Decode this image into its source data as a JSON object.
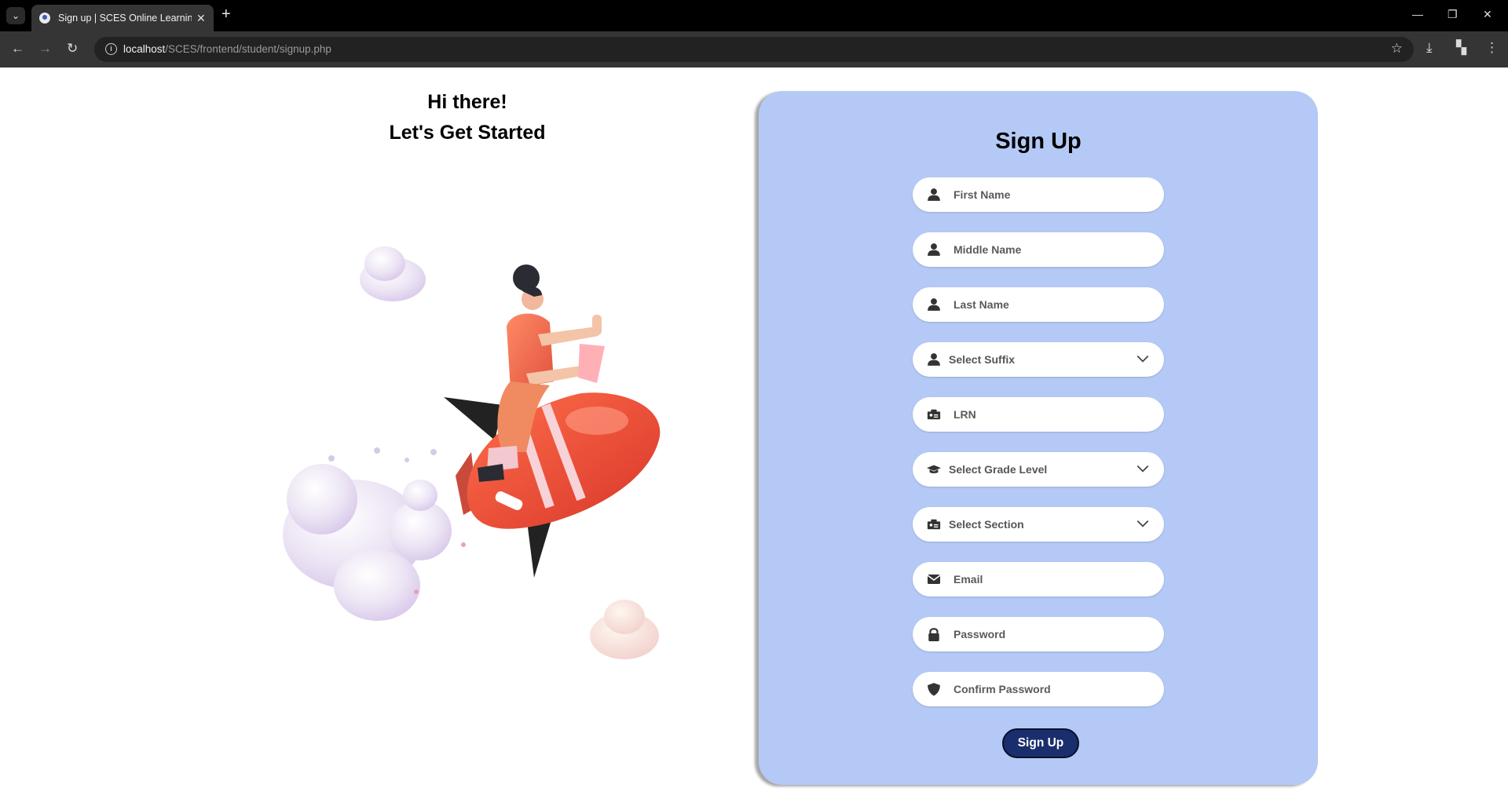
{
  "browser": {
    "tab_title": "Sign up | SCES Online Learning",
    "url_host": "localhost",
    "url_path": "/SCES/frontend/student/signup.php"
  },
  "hero": {
    "greeting_line1": "Hi there!",
    "greeting_line2": "Let's Get Started"
  },
  "form": {
    "title": "Sign Up",
    "fields": {
      "first_name": {
        "placeholder": "First Name",
        "icon": "user-icon"
      },
      "middle_name": {
        "placeholder": "Middle Name",
        "icon": "user-icon"
      },
      "last_name": {
        "placeholder": "Last Name",
        "icon": "user-icon"
      },
      "suffix": {
        "selected": "Select Suffix",
        "icon": "user-icon"
      },
      "lrn": {
        "placeholder": "LRN",
        "icon": "id-card-icon"
      },
      "grade_level": {
        "selected": "Select Grade Level",
        "icon": "graduation-cap-icon"
      },
      "section": {
        "selected": "Select Section",
        "icon": "id-card-icon"
      },
      "email": {
        "placeholder": "Email",
        "icon": "envelope-icon"
      },
      "password": {
        "placeholder": "Password",
        "icon": "lock-icon"
      },
      "confirm_password": {
        "placeholder": "Confirm Password",
        "icon": "shield-icon"
      }
    },
    "submit_label": "Sign Up"
  },
  "colors": {
    "card_bg": "#b5c9f6",
    "button_bg": "#1a2e6e",
    "browser_bg": "#000000"
  }
}
